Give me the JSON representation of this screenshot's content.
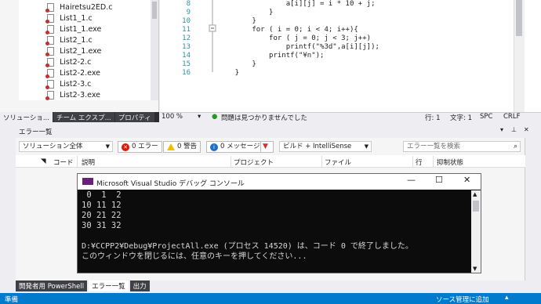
{
  "solution_explorer": {
    "files": [
      "Hairetsu2ED.c",
      "List1_1.c",
      "List1_1.exe",
      "List2_1.c",
      "List2_1.exe",
      "List2-2.c",
      "List2-2.exe",
      "List2-3.c",
      "List2-3.exe"
    ],
    "tabs": [
      "ソリューショ...",
      "チーム エクスプ...",
      "プロパティ"
    ]
  },
  "editor": {
    "line_numbers": [
      "8",
      "9",
      "10",
      "11",
      "12",
      "13",
      "14",
      "15",
      "16"
    ],
    "code_lines": [
      "                a[i][j] = i * 10 + j;",
      "            }",
      "        }",
      "        for ( i = 0; i < 4; i++){",
      "            for ( j = 0; j < 3; j++)",
      "                printf(\"%3d\",a[i][j]);",
      "            printf(\"¥n\");",
      "        }",
      "    }"
    ],
    "zoom": "100 %",
    "issues_status": "問題は見つかりませんでした",
    "line_label": "行: 1",
    "char_label": "文字: 1",
    "spc": "SPC",
    "crlf": "CRLF"
  },
  "error_list": {
    "title": "エラー一覧",
    "scope": "ソリューション全体",
    "errors": "0 エラー",
    "warnings": "0 警告",
    "messages": "0 メッセージ",
    "build_filter": "ビルド + IntelliSense",
    "search_placeholder": "エラー一覧を検索",
    "columns": [
      "コード",
      "説明",
      "プロジェクト",
      "ファイル",
      "行",
      "抑制状態"
    ]
  },
  "console": {
    "title": "Microsoft Visual Studio デバッグ コンソール",
    "output": [
      " 0  1  2",
      "10 11 12",
      "20 21 22",
      "30 31 32",
      "",
      "D:¥CCPP2¥Debug¥ProjectAll.exe (プロセス 14520) は、コード 0 で終了しました。",
      "このウィンドウを閉じるには、任意のキーを押してください..."
    ]
  },
  "bottom_tabs": [
    "開発者用 PowerShell",
    "エラー一覧",
    "出力"
  ],
  "status_bar": {
    "ready": "準備",
    "source_control": "ソース管理に追加"
  },
  "colors": {
    "accent": "#007acc",
    "error": "#e51400",
    "warning": "#f0c000",
    "info": "#1e6ec8"
  }
}
